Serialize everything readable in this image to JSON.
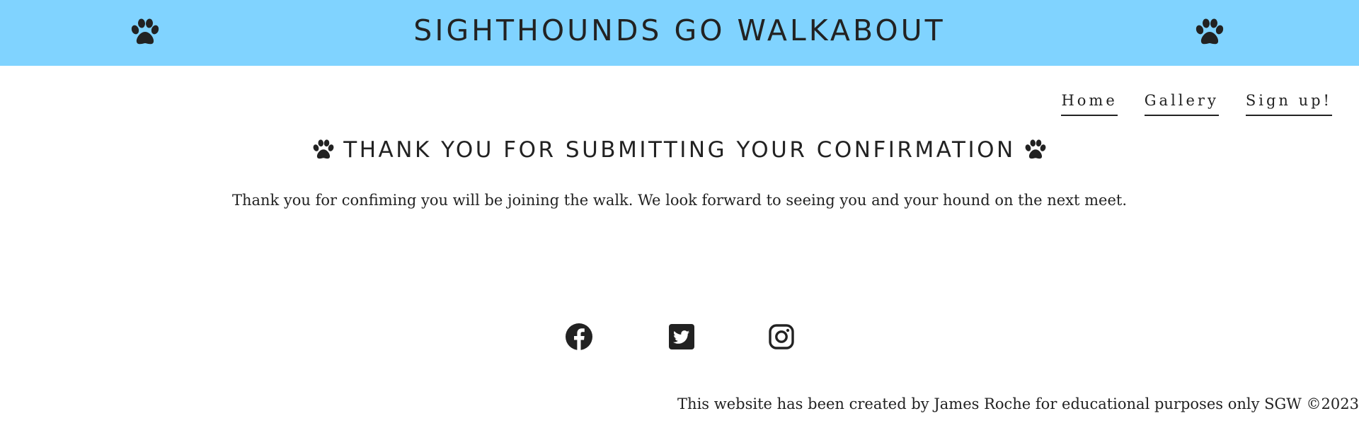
{
  "header": {
    "title": "SIGHTHOUNDS GO WALKABOUT",
    "icon": "paw-icon",
    "background_color": "#80d3ff"
  },
  "nav": {
    "items": [
      {
        "label": "Home"
      },
      {
        "label": "Gallery"
      },
      {
        "label": "Sign up!"
      }
    ]
  },
  "main": {
    "heading": "THANK YOU FOR SUBMITTING YOUR CONFIRMATION",
    "heading_icon": "paw-icon",
    "message": "Thank you for confiming you will be joining the walk. We look forward to seeing you and your hound on the next meet."
  },
  "social": {
    "links": [
      {
        "icon": "facebook-icon"
      },
      {
        "icon": "twitter-icon"
      },
      {
        "icon": "instagram-icon"
      }
    ]
  },
  "footer": {
    "text": "This website has been created by James Roche for educational purposes only SGW ©2023"
  },
  "colors": {
    "text": "#222222",
    "banner": "#80d3ff"
  }
}
